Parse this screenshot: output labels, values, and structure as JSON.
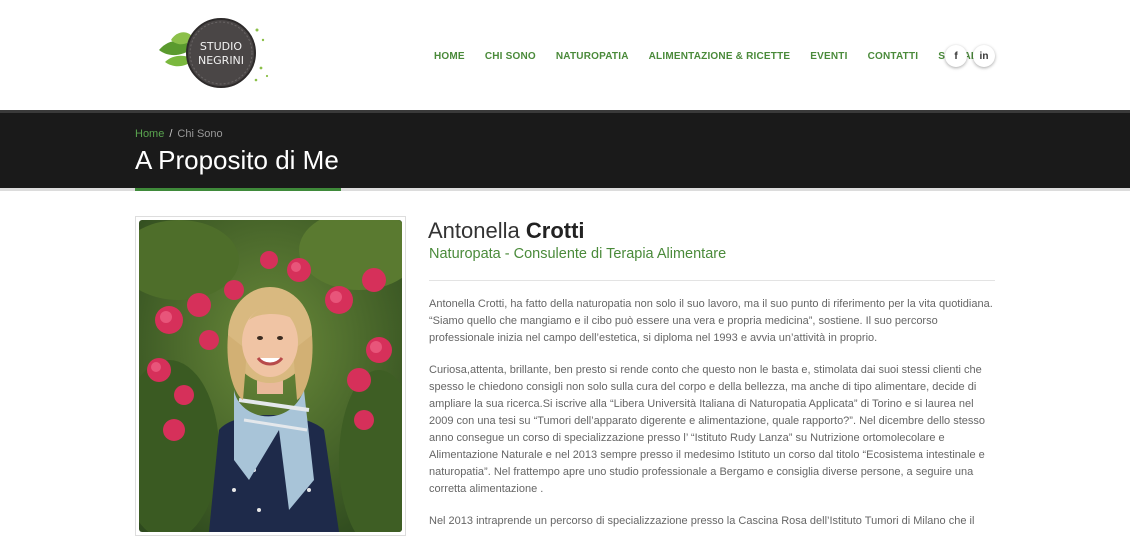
{
  "logo": {
    "line1": "STUDIO",
    "line2": "NEGRINI"
  },
  "nav": {
    "items": [
      "HOME",
      "CHI SONO",
      "NATUROPATIA",
      "ALIMENTAZIONE & RICETTE",
      "EVENTI",
      "CONTATTI",
      "SOCIAL"
    ],
    "color": "#4a8a3a"
  },
  "social": {
    "facebook": "f",
    "linkedin": "in"
  },
  "breadcrumb": {
    "home": "Home",
    "current": "Chi Sono"
  },
  "page_title": "A Proposito di Me",
  "profile": {
    "first_name": "Antonella",
    "last_name": "Crotti",
    "role": "Naturopata - Consulente di Terapia Alimentare"
  },
  "paragraphs": [
    "Antonella Crotti, ha fatto della naturopatia non solo il suo lavoro, ma il suo punto di riferimento per la vita quotidiana. “Siamo quello che mangiamo e il cibo può essere una vera e propria medicina”, sostiene. Il suo percorso professionale inizia nel campo dell’estetica, si diploma nel 1993 e avvia un’attività in proprio.",
    "Curiosa,attenta, brillante, ben presto si rende conto che questo non le basta e, stimolata dai suoi stessi clienti che spesso le chiedono consigli non solo sulla cura del corpo e della bellezza, ma anche di tipo alimentare, decide di ampliare la sua ricerca.Si iscrive alla “Libera Università Italiana di Naturopatia Applicata” di Torino e si laurea nel 2009 con una tesi su “Tumori dell’apparato digerente e alimentazione, quale rapporto?”. Nel dicembre dello stesso anno consegue un corso di specializzazione presso l’ “Istituto Rudy Lanza” su Nutrizione ortomolecolare e Alimentazione Naturale e nel 2013 sempre presso il medesimo Istituto un corso dal titolo “Ecosistema intestinale e naturopatia”. Nel frattempo apre uno studio professionale a Bergamo e consiglia diverse persone, a seguire una corretta alimentazione .",
    "Nel 2013 intraprende un percorso di specializzazione presso la Cascina Rosa dell’Istituto Tumori di Milano che il"
  ]
}
